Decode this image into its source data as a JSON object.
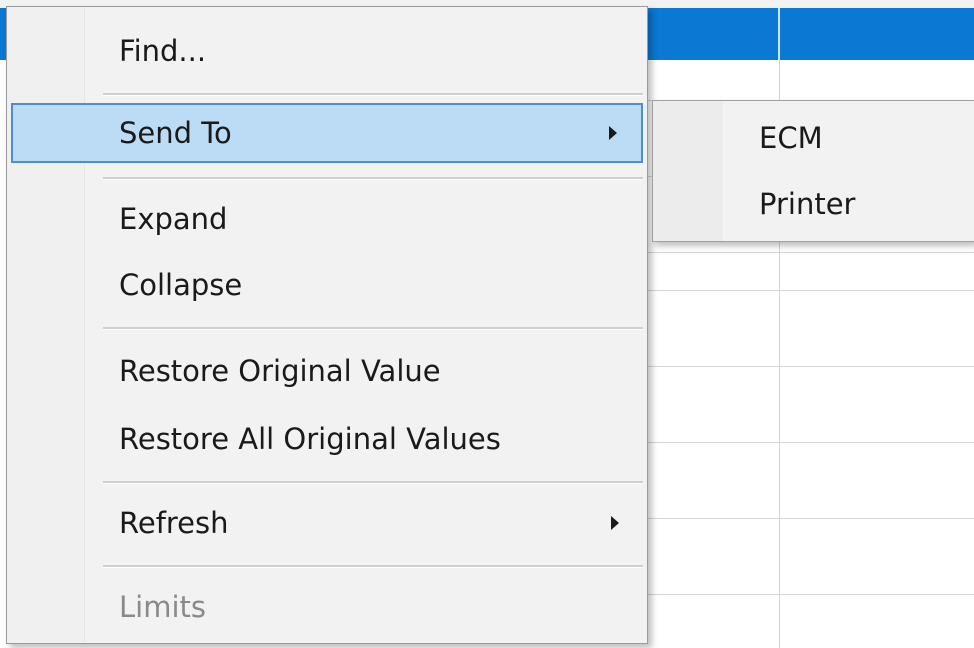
{
  "context_menu": {
    "items": {
      "find": {
        "label": "Find..."
      },
      "send_to": {
        "label": "Send To",
        "has_submenu": true,
        "highlighted": true
      },
      "expand": {
        "label": "Expand"
      },
      "collapse": {
        "label": "Collapse"
      },
      "restore_original_value": {
        "label": "Restore Original Value"
      },
      "restore_all_original_values": {
        "label": "Restore All Original Values"
      },
      "refresh": {
        "label": "Refresh",
        "has_submenu": true
      },
      "limits": {
        "label": "Limits",
        "disabled": true
      }
    }
  },
  "send_to_submenu": {
    "items": [
      {
        "label": "ECM"
      },
      {
        "label": "Printer"
      }
    ]
  },
  "colors": {
    "grid_header": "#0b78d4",
    "highlight_fill": "#bcdcf5",
    "highlight_border": "#4a8fd6",
    "menu_background": "#f2f2f2",
    "disabled_text": "#8a8a8a"
  }
}
